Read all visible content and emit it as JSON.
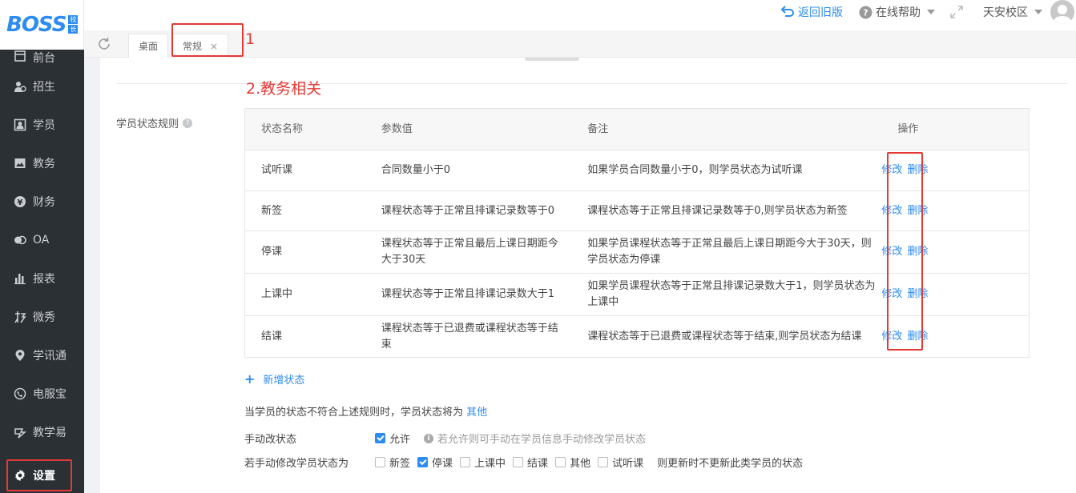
{
  "logo": {
    "text": "BOSS",
    "badge": [
      "校",
      "长"
    ]
  },
  "sidebar": {
    "first_partial": "前台",
    "items": [
      {
        "label": "招生",
        "icon": "recruit-icon"
      },
      {
        "label": "学员",
        "icon": "student-icon"
      },
      {
        "label": "教务",
        "icon": "academic-icon"
      },
      {
        "label": "财务",
        "icon": "finance-icon"
      },
      {
        "label": "OA",
        "icon": "oa-icon"
      },
      {
        "label": "报表",
        "icon": "report-icon"
      },
      {
        "label": "微秀",
        "icon": "weixiu-icon"
      },
      {
        "label": "学讯通",
        "icon": "location-icon"
      },
      {
        "label": "电服宝",
        "icon": "phone-service-icon"
      },
      {
        "label": "教学易",
        "icon": "teaching-icon"
      }
    ],
    "settings": "设置"
  },
  "header": {
    "back_old": "返回旧版",
    "help": "在线帮助",
    "campus": "天安校区"
  },
  "tabs": [
    {
      "label": "桌面"
    },
    {
      "label": "常规",
      "close": "×"
    }
  ],
  "annotations": {
    "one": "1",
    "two": "2.教务相关"
  },
  "status_rules": {
    "label": "学员状态规则",
    "columns": [
      "状态名称",
      "参数值",
      "备注",
      "操作"
    ],
    "rows": [
      {
        "name": "试听课",
        "param": "合同数量小于0",
        "note": "如果学员合同数量小于0，则学员状态为试听课"
      },
      {
        "name": "新签",
        "param": "课程状态等于正常且排课记录数等于0",
        "note": "课程状态等于正常且排课记录数等于0,则学员状态为新签"
      },
      {
        "name": "停课",
        "param": "课程状态等于正常且最后上课日期距今大于30天",
        "note": "如果学员课程状态等于正常且最后上课日期距今大于30天，则学员状态为停课"
      },
      {
        "name": "上课中",
        "param": "课程状态等于正常且排课记录数大于1",
        "note": "如果学员课程状态等于正常且排课记录数大于1，则学员状态为上课中"
      },
      {
        "name": "结课",
        "param": "课程状态等于已退费或课程状态等于结束",
        "note": "课程状态等于已退费或课程状态等于结束,则学员状态为结课"
      }
    ],
    "edit": "修改",
    "delete": "删除",
    "add": "新增状态"
  },
  "fallback": {
    "text": "当学员的状态不符合上述规则时，学员状态将为",
    "value": "其他"
  },
  "manual": {
    "label": "手动改状态",
    "allow": "允许",
    "allow_checked": true,
    "hint": "若允许则可手动在学员信息手动修改学员状态"
  },
  "manual_status": {
    "label": "若手动修改学员状态为",
    "options": [
      {
        "label": "新签",
        "checked": false
      },
      {
        "label": "停课",
        "checked": true
      },
      {
        "label": "上课中",
        "checked": false
      },
      {
        "label": "结课",
        "checked": false
      },
      {
        "label": "其他",
        "checked": false
      },
      {
        "label": "试听课",
        "checked": false
      }
    ],
    "suffix": "则更新时不更新此类学员的状态"
  }
}
